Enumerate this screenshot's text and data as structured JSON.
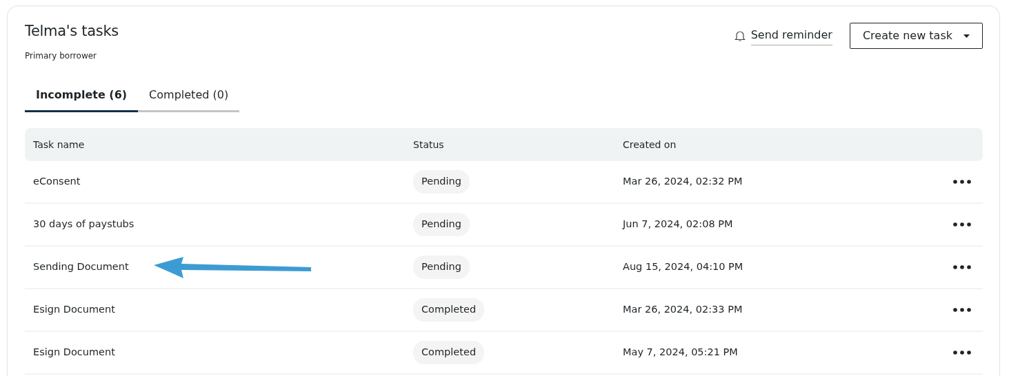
{
  "header": {
    "title": "Telma's tasks",
    "subtitle": "Primary borrower",
    "reminder_link": "Send reminder",
    "create_button": "Create new task"
  },
  "tabs": [
    {
      "label": "Incomplete (6)",
      "selected": true
    },
    {
      "label": "Completed (0)",
      "selected": false
    }
  ],
  "table": {
    "columns": [
      "Task name",
      "Status",
      "Created on"
    ],
    "rows": [
      {
        "task": "eConsent",
        "status": "Pending",
        "created": "Mar 26, 2024, 02:32 PM"
      },
      {
        "task": "30 days of paystubs",
        "status": "Pending",
        "created": "Jun 7, 2024, 02:08 PM"
      },
      {
        "task": "Sending Document",
        "status": "Pending",
        "created": "Aug 15, 2024, 04:10 PM",
        "annotated": true
      },
      {
        "task": "Esign Document",
        "status": "Completed",
        "created": "Mar 26, 2024, 02:33 PM"
      },
      {
        "task": "Esign Document",
        "status": "Completed",
        "created": "May 7, 2024, 05:21 PM"
      }
    ]
  }
}
